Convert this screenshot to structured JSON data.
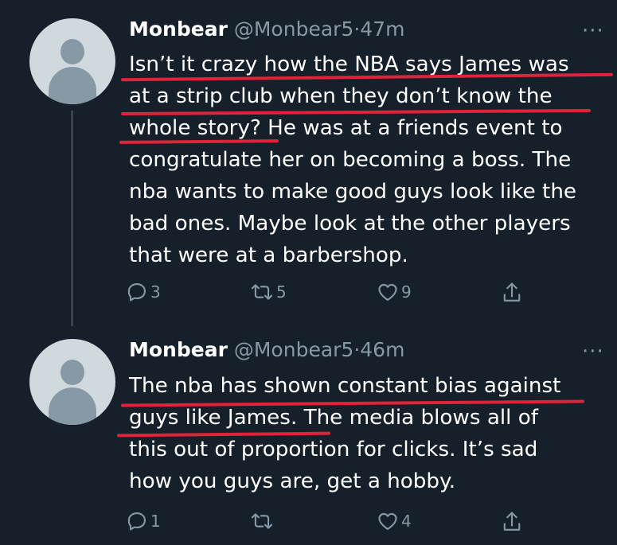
{
  "tweets": [
    {
      "name": "Monbear",
      "handle": "@Monbear5",
      "separator": "·",
      "time": "47m",
      "lines": [
        "Isn’t it crazy how the NBA says James was",
        "at a strip club when they don’t know the",
        "whole story? He was at a friends event to",
        "congratulate her on becoming a boss. The",
        "nba wants to make good guys look like the",
        "bad ones. Maybe look at the other players",
        "that were at a barbershop."
      ],
      "replies": "3",
      "retweets": "5",
      "likes": "9"
    },
    {
      "name": "Monbear",
      "handle": "@Monbear5",
      "separator": "·",
      "time": "46m",
      "lines": [
        "The nba has shown constant bias against",
        "guys like James. The media blows all of",
        "this out of proportion for clicks. It’s sad",
        "how you guys are, get a hobby."
      ],
      "replies": "1",
      "retweets": "",
      "likes": "4"
    }
  ],
  "more_label": "···",
  "icons": [
    "reply-icon",
    "retweet-icon",
    "like-icon",
    "share-icon",
    "more-icon"
  ],
  "colors": {
    "background": "#15202b",
    "text": "#ffffff",
    "muted": "#8899a6",
    "annotation": "#e0233b"
  }
}
